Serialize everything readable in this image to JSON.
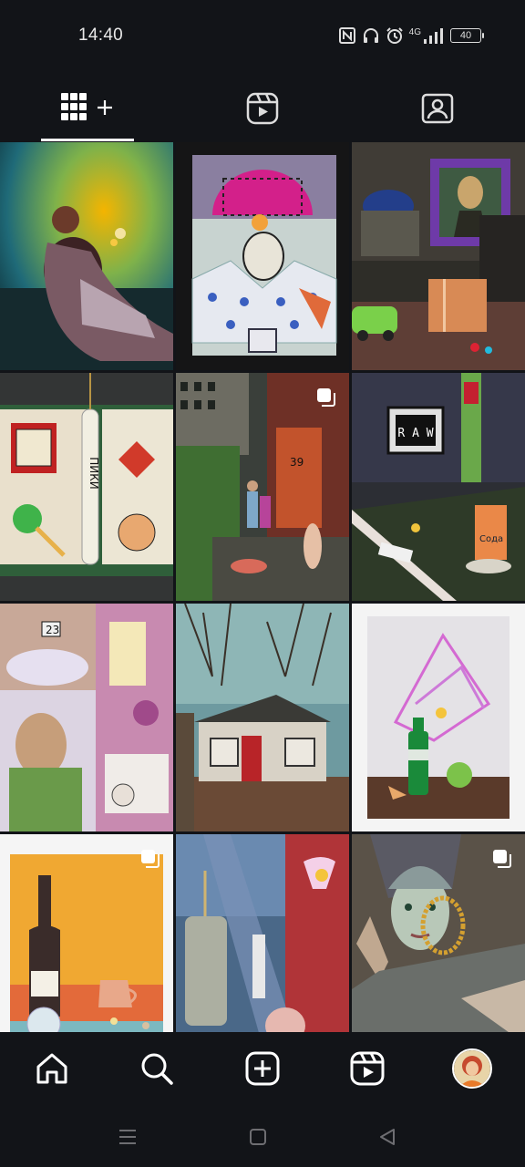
{
  "status_bar": {
    "time": "14:40",
    "network": "4G",
    "battery": "40",
    "icons": [
      "nfc-icon",
      "headphones-icon",
      "alarm-icon",
      "signal-icon",
      "battery-icon"
    ]
  },
  "profile_tabs": [
    {
      "name": "posts-grid",
      "icon": "grid-add-icon",
      "selected": true
    },
    {
      "name": "reels",
      "icon": "reels-icon",
      "selected": false
    },
    {
      "name": "tagged",
      "icon": "tagged-person-icon",
      "selected": false
    }
  ],
  "grid_posts": [
    {
      "row": 1,
      "col": 1,
      "subject": "woman-in-colored-light",
      "multi": false
    },
    {
      "row": 1,
      "col": 2,
      "subject": "collage-face-tiles",
      "multi": false
    },
    {
      "row": 1,
      "col": 3,
      "subject": "mona-lisa-frame-still-life",
      "multi": false
    },
    {
      "row": 2,
      "col": 1,
      "subject": "playing-card-collage",
      "text": "ПИКИ",
      "multi": false
    },
    {
      "row": 2,
      "col": 2,
      "subject": "backyard-scene-door",
      "text": "39",
      "multi": true
    },
    {
      "row": 2,
      "col": 3,
      "subject": "raw-sign-still-life",
      "text": "R A W",
      "multi": false
    },
    {
      "row": 3,
      "col": 1,
      "subject": "pastel-collage",
      "text": "23",
      "multi": false
    },
    {
      "row": 3,
      "col": 2,
      "subject": "old-house-trees",
      "multi": false
    },
    {
      "row": 3,
      "col": 3,
      "subject": "bottle-straws-still-life",
      "multi": false
    },
    {
      "row": 4,
      "col": 1,
      "subject": "wine-bottle-orange",
      "multi": true
    },
    {
      "row": 4,
      "col": 2,
      "subject": "glass-objects-still-life",
      "multi": false
    },
    {
      "row": 4,
      "col": 3,
      "subject": "portrait-with-chain",
      "multi": true
    }
  ],
  "bottom_nav": [
    {
      "name": "home",
      "icon": "home-icon"
    },
    {
      "name": "search",
      "icon": "search-icon"
    },
    {
      "name": "create",
      "icon": "plus-square-icon"
    },
    {
      "name": "reels",
      "icon": "reels-icon"
    },
    {
      "name": "profile",
      "icon": "avatar"
    }
  ],
  "system_nav": [
    {
      "name": "menu",
      "icon": "menu-lines-icon"
    },
    {
      "name": "home",
      "icon": "square-icon"
    },
    {
      "name": "back",
      "icon": "back-triangle-icon"
    }
  ],
  "colors": {
    "background": "#121418",
    "icon": "#ffffff",
    "system_icon": "#6e6e72"
  }
}
